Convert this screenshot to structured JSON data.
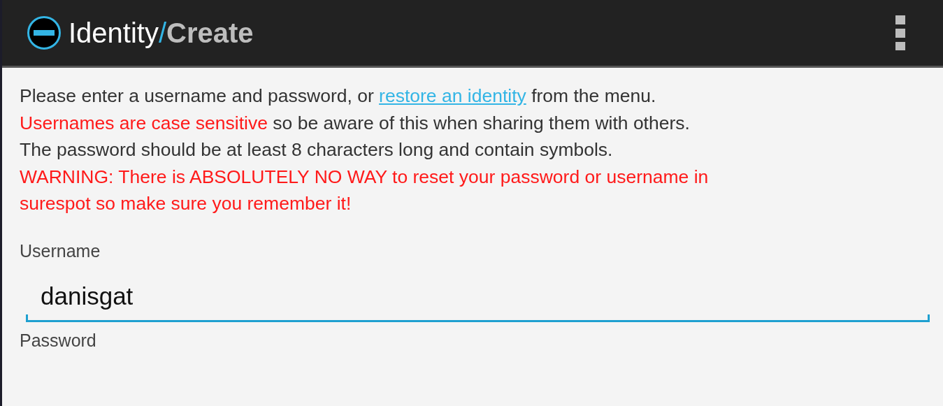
{
  "action_bar": {
    "title": "Identity",
    "separator": "/",
    "subtitle": "Create"
  },
  "intro": {
    "lines": [
      [
        {
          "kind": "plain",
          "text": "Please enter a username and password, or "
        },
        {
          "kind": "link",
          "text": "restore an identity"
        },
        {
          "kind": "plain",
          "text": " from the menu."
        }
      ],
      [
        {
          "kind": "warning",
          "text": "Usernames are case sensitive"
        },
        {
          "kind": "plain",
          "text": " so be aware of this when sharing them with others."
        }
      ],
      [
        {
          "kind": "plain",
          "text": "The password should be at least 8 characters long and contain symbols."
        }
      ],
      [
        {
          "kind": "warning",
          "text": "WARNING: There is ABSOLUTELY NO WAY to reset your password or username in"
        }
      ],
      [
        {
          "kind": "warning",
          "text": "surespot so make sure you remember it!"
        }
      ]
    ]
  },
  "fields": [
    {
      "label": "Username",
      "value": "danisgat",
      "focused": true
    },
    {
      "label": "Password"
    }
  ]
}
